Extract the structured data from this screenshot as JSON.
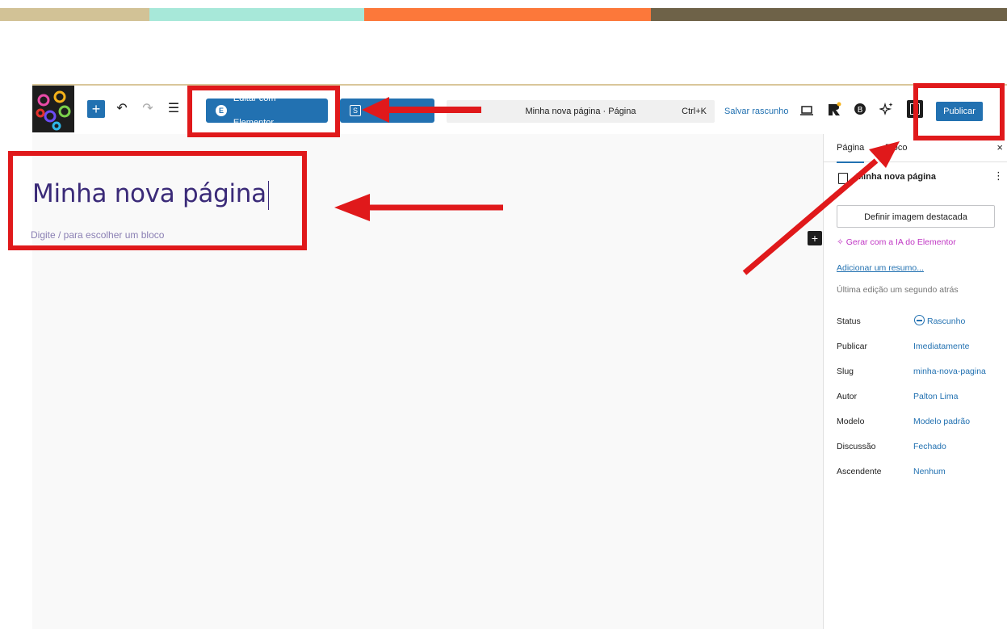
{
  "colors": {
    "strip": [
      "#d2c296",
      "#a7e8d9",
      "#fc783a",
      "#6e6248"
    ],
    "accent": "#2271b1",
    "annotation_red": "#e0191b",
    "title_purple": "#3a2a78",
    "ai_pink": "#c036c4"
  },
  "toolbar": {
    "add_icon": "plus-icon",
    "undo_icon": "undo-icon",
    "redo_icon": "redo-icon",
    "list_view_icon": "list-view-icon",
    "elementor_button": "Editar com Elementor",
    "second_button": "",
    "command_bar_title": "Minha nova página · Página",
    "command_bar_shortcut": "Ctrl+K",
    "save_draft": "Salvar rascunho",
    "preview_icon": "desktop-preview-icon",
    "publish": "Publicar",
    "more_icon": "more-vertical-icon"
  },
  "editor": {
    "title": "Minha nova página",
    "placeholder": "Digite / para escolher um bloco"
  },
  "sidebar": {
    "tabs": [
      "Página",
      "Bloco"
    ],
    "close": "×",
    "page_title": "Minha nova página",
    "featured_image": "Definir imagem destacada",
    "ai_link": "Gerar com a IA do Elementor",
    "summary_link": "Adicionar um resumo...",
    "last_edit": "Última edição um segundo atrás",
    "meta": [
      {
        "label": "Status",
        "value": "Rascunho"
      },
      {
        "label": "Publicar",
        "value": "Imediatamente"
      },
      {
        "label": "Slug",
        "value": "minha-nova-pagina"
      },
      {
        "label": "Autor",
        "value": "Palton Lima"
      },
      {
        "label": "Modelo",
        "value": "Modelo padrão"
      },
      {
        "label": "Discussão",
        "value": "Fechado"
      },
      {
        "label": "Ascendente",
        "value": "Nenhum"
      }
    ]
  }
}
